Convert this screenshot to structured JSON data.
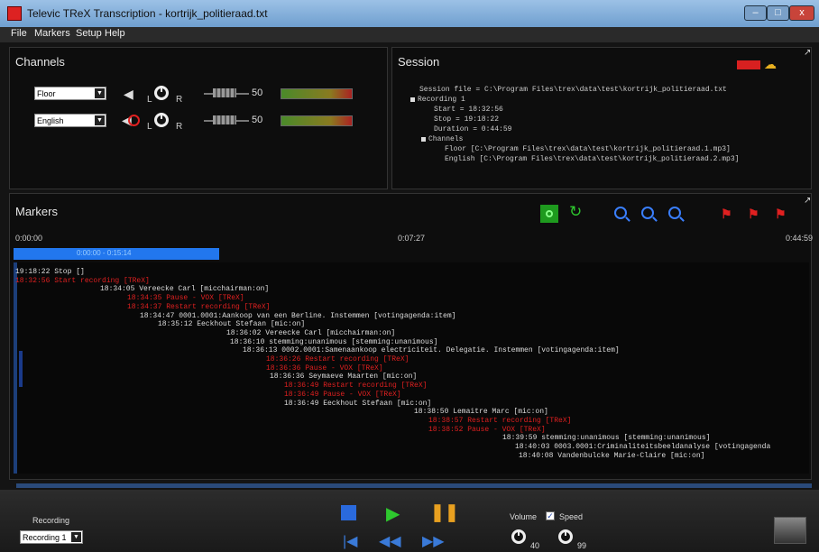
{
  "window": {
    "title": "Televic TReX Transcription - kortrijk_politieraad.txt",
    "min": "–",
    "max": "□",
    "close": "x"
  },
  "menu": [
    "File",
    "Markers",
    "Setup",
    "Help"
  ],
  "channels": {
    "title": "Channels",
    "rows": [
      {
        "source": "Floor",
        "volume": "50",
        "muted": false
      },
      {
        "source": "English",
        "volume": "50",
        "muted": true
      }
    ],
    "left_label": "L",
    "right_label": "R"
  },
  "session": {
    "title": "Session",
    "file_line": "Session file = C:\\Program Files\\trex\\data\\test\\kortrijk_politieraad.txt",
    "recording": "Recording 1",
    "start": "Start     = 18:32:56",
    "stop": "Stop      = 19:18:22",
    "duration": "Duration = 0:44:59",
    "channels_label": "Channels",
    "floor_line": "Floor [C:\\Program Files\\trex\\data\\test\\kortrijk_politieraad.1.mp3]",
    "english_line": "English [C:\\Program Files\\trex\\data\\test\\kortrijk_politieraad.2.mp3]"
  },
  "markers": {
    "title": "Markers",
    "time_start": "0:00:00",
    "time_mid": "0:07:27",
    "time_end": "0:44:59",
    "range": "0:00:00 - 0:15:14",
    "lines": [
      {
        "text": "19:18:22 Stop []",
        "color": "#dddddd"
      },
      {
        "text": "18:32:56 Start recording [TReX]",
        "color": "#e02020"
      },
      {
        "text": "18:34:05 Vereecke Carl [micchairman:on]",
        "color": "#dddddd"
      },
      {
        "text": "18:34:35 Pause - VOX [TReX]",
        "color": "#e02020"
      },
      {
        "text": "18:34:37 Restart recording [TReX]",
        "color": "#e02020"
      },
      {
        "text": "18:34:47 0001.0001:Aankoop van een Berline. Instemmen [votingagenda:item]",
        "color": "#dddddd"
      },
      {
        "text": "18:35:12 Eeckhout Stefaan [mic:on]",
        "color": "#dddddd"
      },
      {
        "text": "18:36:02 Vereecke Carl [micchairman:on]",
        "color": "#dddddd"
      },
      {
        "text": "18:36:10 stemming:unanimous [stemming:unanimous]",
        "color": "#dddddd"
      },
      {
        "text": "18:36:13 0002.0001:Samenaankoop electriciteit. Delegatie. Instemmen [votingagenda:item]",
        "color": "#dddddd"
      },
      {
        "text": "18:36:26 Restart recording [TReX]",
        "color": "#e02020"
      },
      {
        "text": "18:36:36 Pause - VOX [TReX]",
        "color": "#e02020"
      },
      {
        "text": "18:36:36 Seymaeve Maarten [mic:on]",
        "color": "#dddddd"
      },
      {
        "text": "18:36:49 Restart recording [TReX]",
        "color": "#e02020"
      },
      {
        "text": "18:36:49 Pause - VOX [TReX]",
        "color": "#e02020"
      },
      {
        "text": "18:36:49 Eeckhout Stefaan [mic:on]",
        "color": "#dddddd"
      },
      {
        "text": "18:38:50 Lemaitre Marc [mic:on]",
        "color": "#dddddd"
      },
      {
        "text": "18:38:57 Restart recording [TReX]",
        "color": "#e02020"
      },
      {
        "text": "18:38:52 Pause - VOX [TReX]",
        "color": "#e02020"
      },
      {
        "text": "18:39:59 stemming:unanimous [stemming:unanimous]",
        "color": "#dddddd"
      },
      {
        "text": "18:40:03 0003.0001:Criminaliteitsbeeldanalyse [votingagenda",
        "color": "#dddddd"
      },
      {
        "text": "18:40:08 Vandenbulcke Marie-Claire [mic:on]",
        "color": "#dddddd"
      }
    ]
  },
  "bottom": {
    "recording_label": "Recording",
    "recording_value": "Recording 1",
    "volume_label": "Volume",
    "speed_label": "Speed",
    "volume_value": "40",
    "speed_value": "99"
  }
}
